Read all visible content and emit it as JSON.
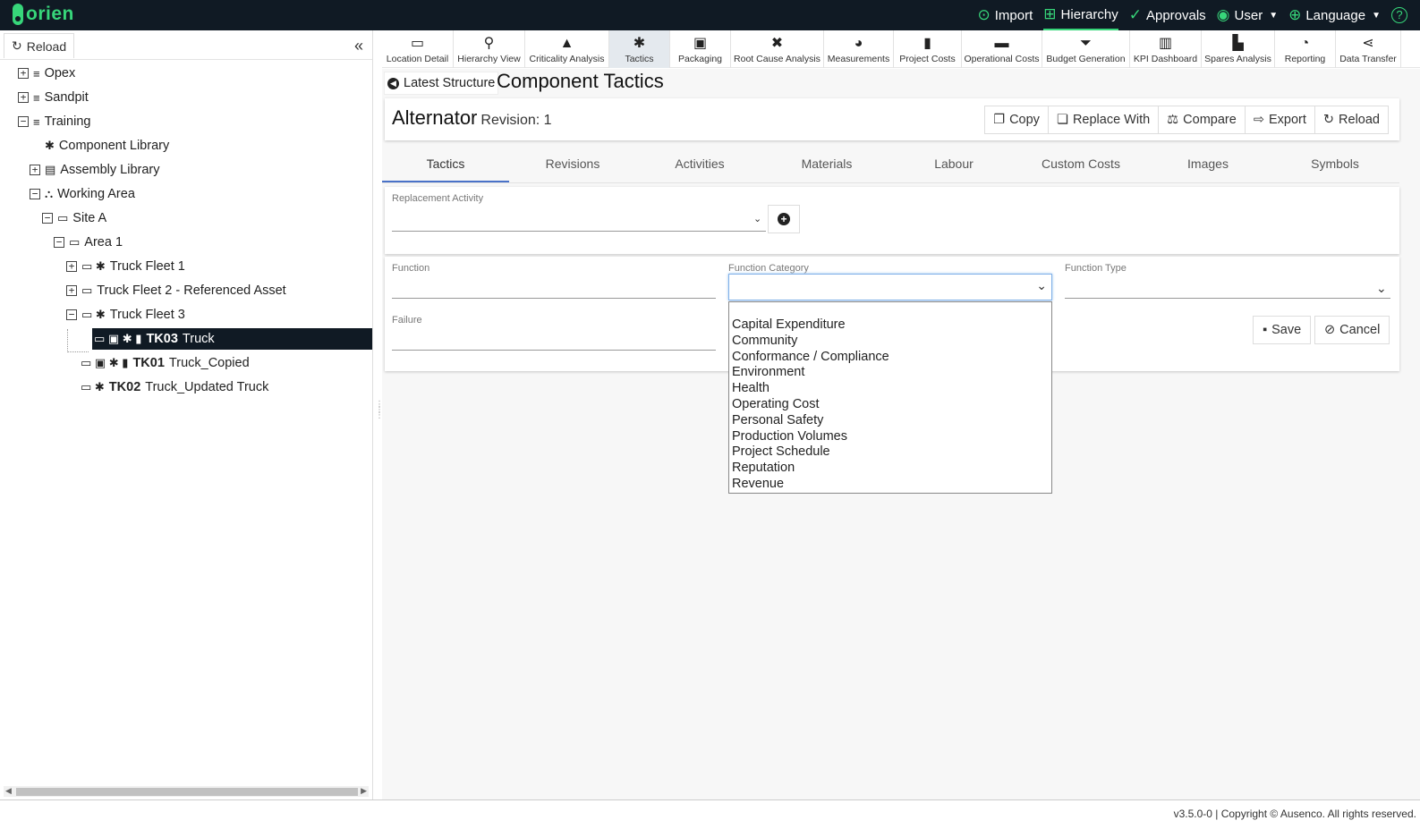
{
  "brand": {
    "name": "orien",
    "color": "#37d67a"
  },
  "topnav": [
    {
      "label": "Import",
      "icon": "lightbulb-icon",
      "glyph": "⊙"
    },
    {
      "label": "Hierarchy",
      "icon": "sitemap-icon",
      "glyph": "⊞",
      "active": true
    },
    {
      "label": "Approvals",
      "icon": "check-circle-icon",
      "glyph": "✓"
    },
    {
      "label": "User",
      "icon": "user-icon",
      "glyph": "◉",
      "caret": "▼"
    },
    {
      "label": "Language",
      "icon": "globe-icon",
      "glyph": "⊕",
      "caret": "▼"
    },
    {
      "label": "",
      "icon": "help-icon",
      "glyph": "?"
    }
  ],
  "left": {
    "reload_label": "Reload",
    "collapse_glyph": "«",
    "tree": [
      {
        "pm": "+",
        "icons": "≡",
        "label": "Opex",
        "bold": ""
      },
      {
        "pm": "+",
        "icons": "≡",
        "label": "Sandpit",
        "bold": ""
      },
      {
        "pm": "−",
        "icons": "≡",
        "label": "Training",
        "bold": ""
      },
      {
        "pm": "",
        "icons": "✱",
        "label": "Component Library",
        "bold": ""
      },
      {
        "pm": "+",
        "icons": "▤",
        "label": "Assembly Library",
        "bold": ""
      },
      {
        "pm": "−",
        "icons": "⛬",
        "label": "Working Area",
        "bold": ""
      },
      {
        "pm": "−",
        "icons": "▭",
        "label": "Site A",
        "bold": ""
      },
      {
        "pm": "−",
        "icons": "▭",
        "label": "Area 1",
        "bold": ""
      },
      {
        "pm": "+",
        "icons": "▭ ✱",
        "label": "Truck Fleet 1",
        "bold": ""
      },
      {
        "pm": "+",
        "icons": "▭",
        "label": "Truck Fleet 2 - Referenced Asset",
        "bold": ""
      },
      {
        "pm": "−",
        "icons": "▭ ✱",
        "label": "Truck Fleet 3",
        "bold": ""
      },
      {
        "pm": "",
        "icons": "▭ ▣ ✱ ▮",
        "label": "Truck",
        "bold": "TK03",
        "selected": true
      },
      {
        "pm": "",
        "icons": "▭ ▣ ✱ ▮",
        "label": "Truck_Copied",
        "bold": "TK01"
      },
      {
        "pm": "",
        "icons": "▭ ✱",
        "label": "Truck_Updated Truck",
        "bold": "TK02"
      }
    ]
  },
  "toolbar": [
    {
      "label": "Location Detail",
      "icon": "folder-icon",
      "glyph": "▭"
    },
    {
      "label": "Hierarchy View",
      "icon": "search-icon",
      "glyph": "⚲"
    },
    {
      "label": "Criticality Analysis",
      "icon": "warning-icon",
      "glyph": "▲"
    },
    {
      "label": "Tactics",
      "icon": "gear-icon",
      "glyph": "✱",
      "active": true
    },
    {
      "label": "Packaging",
      "icon": "package-icon",
      "glyph": "▣"
    },
    {
      "label": "Root Cause Analysis",
      "icon": "tools-icon",
      "glyph": "✖"
    },
    {
      "label": "Measurements",
      "icon": "gauge-icon",
      "glyph": "◕"
    },
    {
      "label": "Project Costs",
      "icon": "invoice-icon",
      "glyph": "▮"
    },
    {
      "label": "Operational Costs",
      "icon": "credit-card-icon",
      "glyph": "▬"
    },
    {
      "label": "Budget Generation",
      "icon": "filter-dollar-icon",
      "glyph": "⏷"
    },
    {
      "label": "KPI Dashboard",
      "icon": "bar-chart-icon",
      "glyph": "▥"
    },
    {
      "label": "Spares Analysis",
      "icon": "warehouse-icon",
      "glyph": "▙"
    },
    {
      "label": "Reporting",
      "icon": "pie-chart-icon",
      "glyph": "◔"
    },
    {
      "label": "Data Transfer",
      "icon": "share-icon",
      "glyph": "⋖"
    }
  ],
  "main": {
    "back_label": "Latest Structure",
    "title": "Component Tactics",
    "component_name": "Alternator",
    "revision": "Revision: 1",
    "actions": [
      {
        "label": "Copy",
        "icon": "copy-icon",
        "glyph": "❐"
      },
      {
        "label": "Replace With",
        "icon": "replace-icon",
        "glyph": "❏"
      },
      {
        "label": "Compare",
        "icon": "balance-scale-icon",
        "glyph": "⚖"
      },
      {
        "label": "Export",
        "icon": "export-icon",
        "glyph": "⇨"
      },
      {
        "label": "Reload",
        "icon": "reload-icon",
        "glyph": "↻"
      }
    ],
    "tabs": [
      "Tactics",
      "Revisions",
      "Activities",
      "Materials",
      "Labour",
      "Custom Costs",
      "Images",
      "Symbols"
    ],
    "active_tab": "Tactics",
    "replacement_activity_label": "Replacement Activity",
    "function_label": "Function",
    "function_category_label": "Function Category",
    "function_type_label": "Function Type",
    "failure_label": "Failure",
    "category_options": [
      "Capital Expenditure",
      "Community",
      "Conformance / Compliance",
      "Environment",
      "Health",
      "Operating Cost",
      "Personal Safety",
      "Production Volumes",
      "Project Schedule",
      "Reputation",
      "Revenue"
    ],
    "save_label": "Save",
    "cancel_label": "Cancel"
  },
  "footer": {
    "text": "v3.5.0-0 | Copyright © Ausenco. All rights reserved."
  }
}
